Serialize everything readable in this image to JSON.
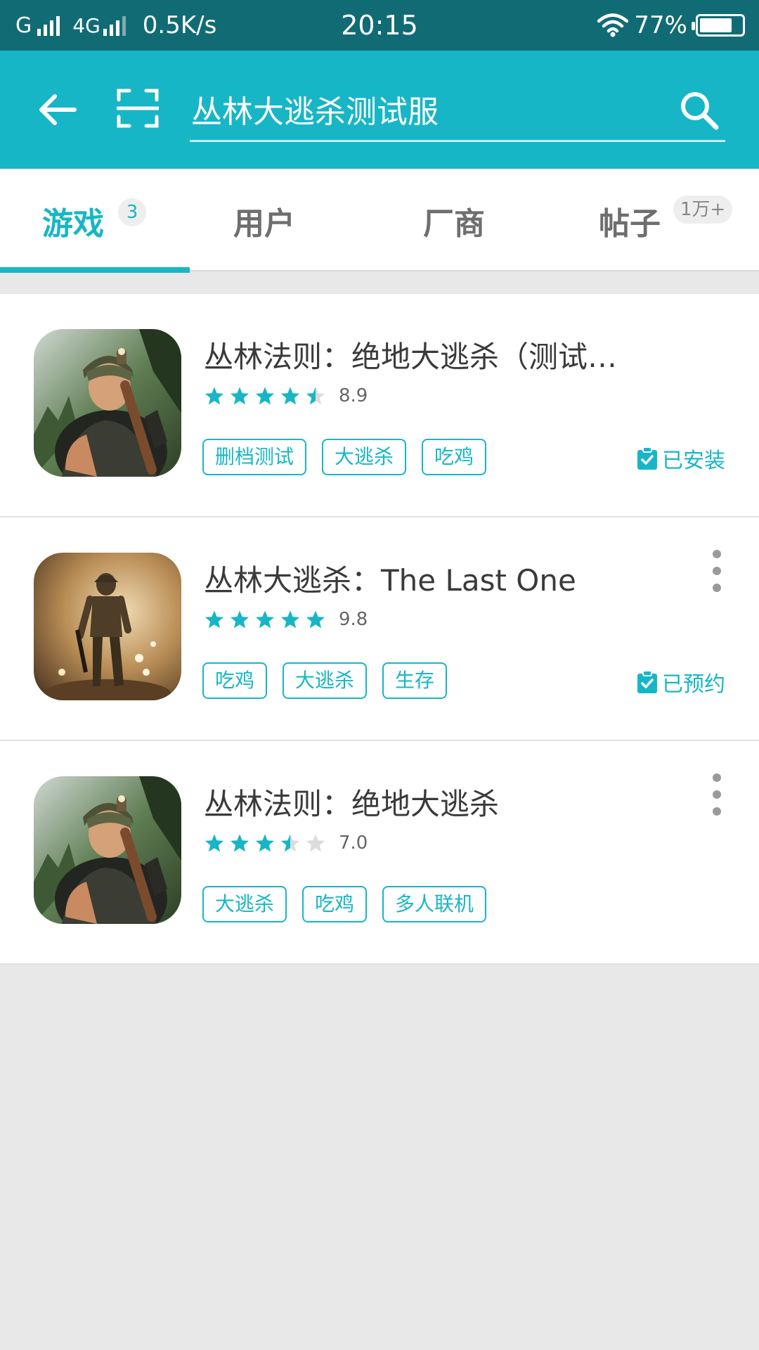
{
  "status_bar": {
    "carrier": "G",
    "network": "4G",
    "speed": "0.5K/s",
    "time": "20:15",
    "battery": "77%",
    "battery_level": 0.77
  },
  "search": {
    "query": "丛林大逃杀测试服",
    "placeholder": ""
  },
  "tabs": [
    {
      "label": "游戏",
      "badge": "3",
      "active": true
    },
    {
      "label": "用户",
      "badge": ""
    },
    {
      "label": "厂商",
      "badge": ""
    },
    {
      "label": "帖子",
      "badge": "1万+"
    }
  ],
  "results": [
    {
      "title": "丛林法则：绝地大逃杀（测试…",
      "stars": 4.5,
      "score": "8.9",
      "tags": [
        "删档测试",
        "大逃杀",
        "吃鸡"
      ],
      "status": "已安装",
      "icon": "soldier-helmet-forest-icon"
    },
    {
      "title": "丛林大逃杀：The Last One",
      "stars": 5,
      "score": "9.8",
      "tags": [
        "吃鸡",
        "大逃杀",
        "生存"
      ],
      "status": "已预约",
      "icon": "soldier-walking-battlefield-icon"
    },
    {
      "title": "丛林法则：绝地大逃杀",
      "stars": 3.5,
      "score": "7.0",
      "tags": [
        "大逃杀",
        "吃鸡",
        "多人联机"
      ],
      "status": "",
      "icon": "soldier-helmet-forest-icon"
    }
  ],
  "colors": {
    "status_bar": "#116b74",
    "accent": "#17b6c6",
    "background": "#e8e8e8"
  }
}
